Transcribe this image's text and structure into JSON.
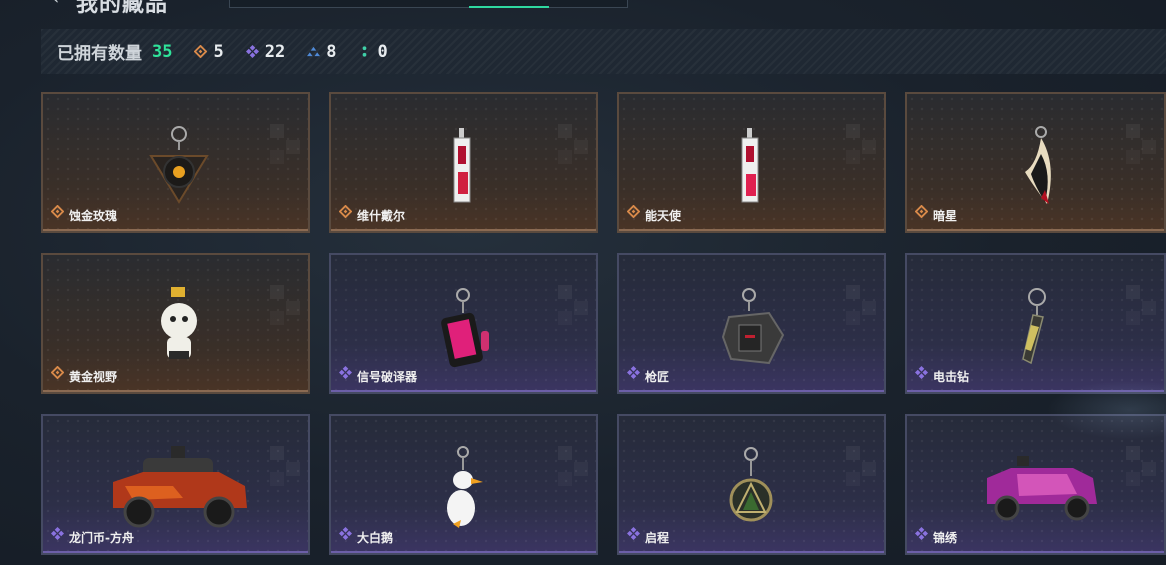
{
  "header": {
    "title": "我的藏品",
    "back_icon": "back-arrow-icon"
  },
  "stats": {
    "owned_label": "已拥有数量",
    "owned_count": "35",
    "rarities": [
      {
        "icon": "gold-diamond-icon",
        "color": "#d98a4a",
        "count": "5"
      },
      {
        "icon": "purple-diamond-icon",
        "color": "#8a72e0",
        "count": "22"
      },
      {
        "icon": "blue-triangle-icon",
        "color": "#4f8ad8",
        "count": "8"
      },
      {
        "icon": "green-colon-icon",
        "color": "#3fd0a8",
        "count": "0"
      }
    ]
  },
  "items": [
    {
      "name": "蚀金玫瑰",
      "rarity": "gold"
    },
    {
      "name": "维什戴尔",
      "rarity": "gold"
    },
    {
      "name": "能天使",
      "rarity": "gold"
    },
    {
      "name": "暗星",
      "rarity": "gold"
    },
    {
      "name": "黄金视野",
      "rarity": "gold"
    },
    {
      "name": "信号破译器",
      "rarity": "purple"
    },
    {
      "name": "枪匠",
      "rarity": "purple"
    },
    {
      "name": "电击钻",
      "rarity": "purple"
    },
    {
      "name": "龙门币-方舟",
      "rarity": "purple"
    },
    {
      "name": "大白鹅",
      "rarity": "purple"
    },
    {
      "name": "启程",
      "rarity": "purple"
    },
    {
      "name": "锦绣",
      "rarity": "purple"
    }
  ],
  "colors": {
    "accent": "#2fe39a",
    "gold": "#d98a4a",
    "purple": "#8a72e0"
  }
}
